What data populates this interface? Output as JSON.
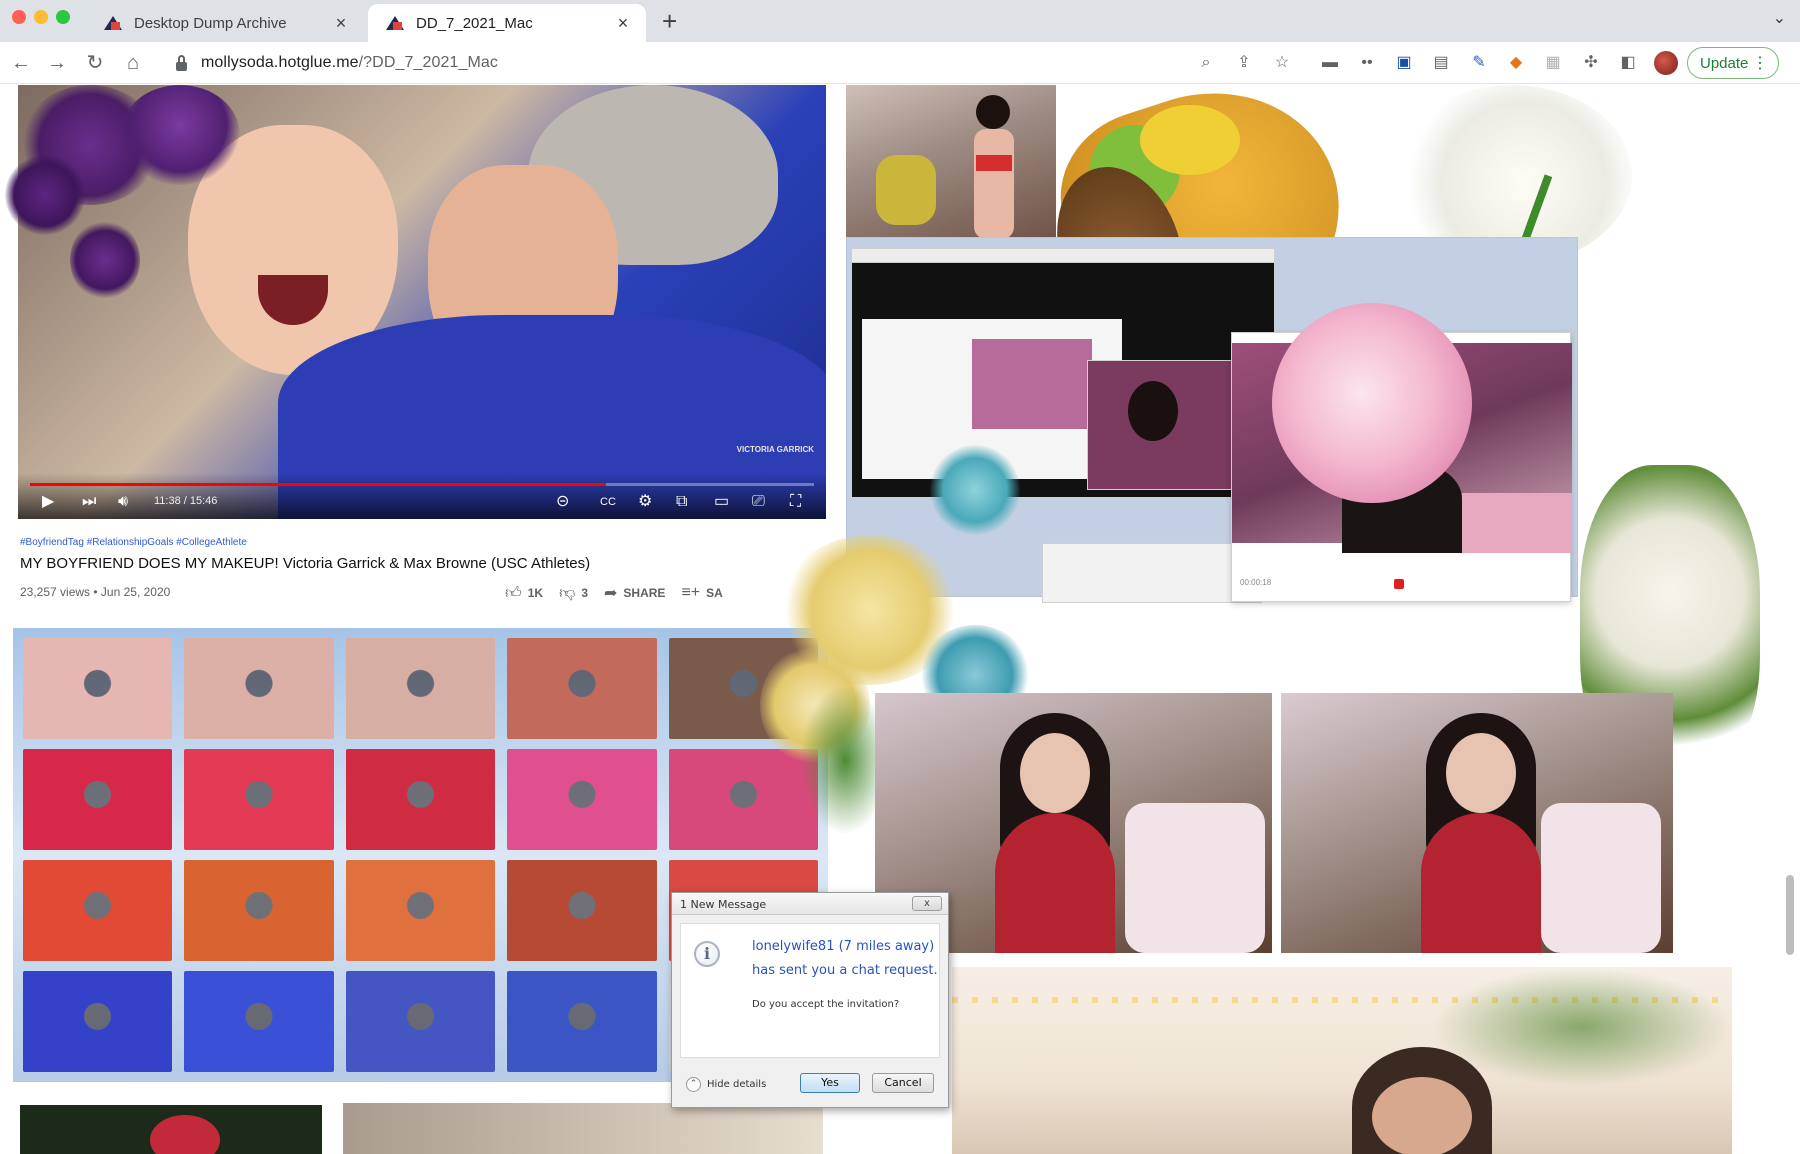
{
  "tabs": [
    {
      "title": "Desktop Dump Archive",
      "active": false
    },
    {
      "title": "DD_7_2021_Mac",
      "active": true
    }
  ],
  "toolbar": {
    "url_host": "mollysoda.hotglue.me",
    "url_path": "/?DD_7_2021_Mac",
    "update_label": "Update",
    "icons": [
      "back-arrow-icon",
      "forward-arrow-icon",
      "reload-icon",
      "home-icon",
      "zoom-icon",
      "share-icon",
      "bookmark-star-icon",
      "extension-icons",
      "puzzle-icon",
      "side-panel-icon"
    ]
  },
  "video": {
    "watermark": "VICTORIA GARRICK",
    "time": "11:38 / 15:46",
    "progress": 0.735,
    "hashtags": "#BoyfriendTag #RelationshipGoals #CollegeAthlete",
    "title": "MY BOYFRIEND DOES MY MAKEUP! Victoria Garrick & Max Browne (USC Athletes)",
    "meta": "23,257 views • Jun 25, 2020",
    "likes": "1K",
    "dislikes": "3",
    "share_label": "SHARE",
    "save_label": "SA"
  },
  "grid_colors": [
    "#e6b7b2",
    "#dcb0a7",
    "#d6aea3",
    "#c46a5a",
    "#7a5a4a",
    "#d8284a",
    "#e33a55",
    "#cf2b43",
    "#e0508e",
    "#d7497a",
    "#e14a34",
    "#d96432",
    "#e0703e",
    "#b74a34",
    "#d94a43",
    "#3342c8",
    "#3a50d6",
    "#4456c2",
    "#3c55c4",
    "#d3d3d3"
  ],
  "webcam": {
    "timestamp": "00:00:18"
  },
  "dialog": {
    "title": "1 New Message",
    "close_label": "x",
    "line1": "lonelywife81 (7 miles away)",
    "line2": "has sent you a chat request.",
    "question": "Do you accept the invitation?",
    "details_label": "Hide details",
    "yes_label": "Yes",
    "cancel_label": "Cancel"
  }
}
